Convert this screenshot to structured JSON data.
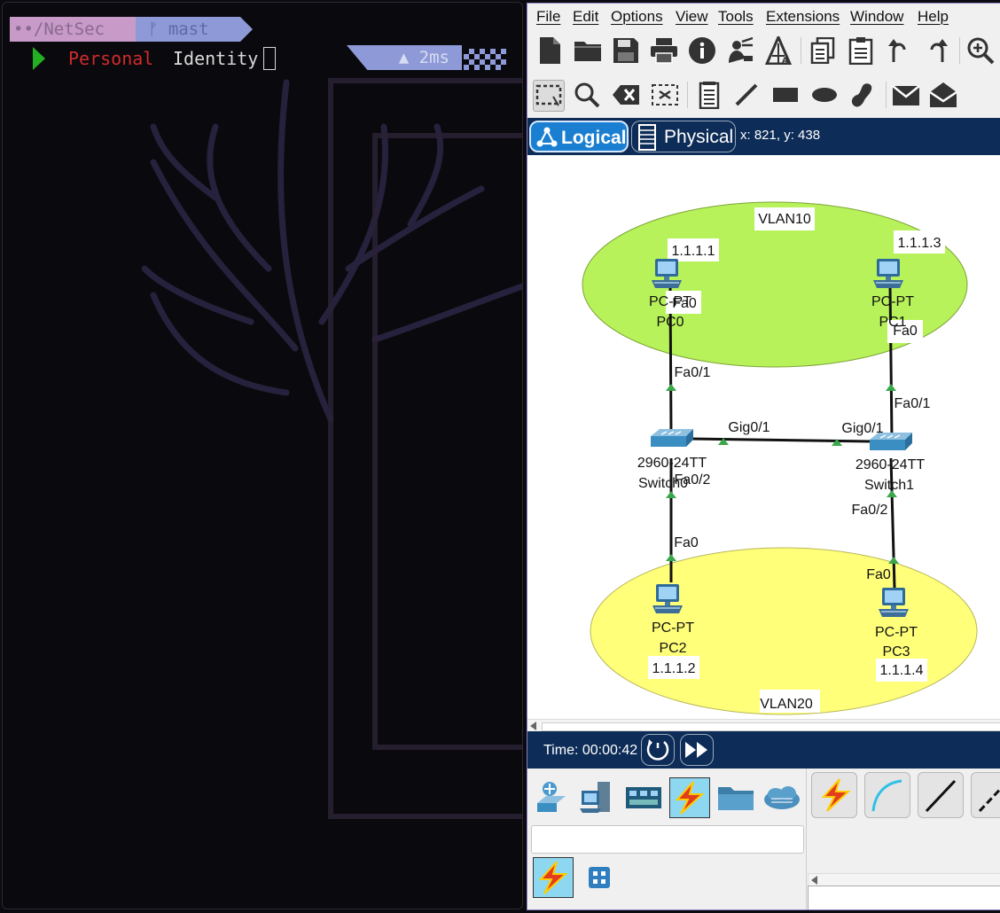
{
  "terminal": {
    "path_segment": "••/NetSec",
    "git_segment": "ᚠ mast",
    "command_word1": "Personal",
    "command_word2": "Identity",
    "exec_time": "▲ 2ms"
  },
  "packet_tracer": {
    "menu": [
      "File",
      "Edit",
      "Options",
      "View",
      "Tools",
      "Extensions",
      "Window",
      "Help"
    ],
    "toolbar1_icons": [
      "new-file-icon",
      "open-folder-icon",
      "save-icon",
      "print-icon",
      "info-icon",
      "network-wizard-icon",
      "activity-wizard-icon",
      "copy-icon",
      "paste-icon",
      "undo-icon",
      "redo-icon",
      "zoom-in-icon"
    ],
    "toolbar2_icons": [
      "select-icon",
      "inspect-icon",
      "delete-icon",
      "resize-icon",
      "note-icon",
      "line-icon",
      "rectangle-icon",
      "ellipse-icon",
      "freeform-icon",
      "add-pdu-icon",
      "add-complex-pdu-icon"
    ],
    "tabs": {
      "logical": "Logical",
      "physical": "Physical"
    },
    "coords": "x: 821, y: 438",
    "topology": {
      "vlan10": "VLAN10",
      "vlan20": "VLAN20",
      "pc0": {
        "model": "PC-PT",
        "name": "PC0",
        "ip": "1.1.1.1",
        "port": "Fa0"
      },
      "pc1": {
        "model": "PC-PT",
        "name": "PC1",
        "ip": "1.1.1.3",
        "port": "Fa0"
      },
      "pc2": {
        "model": "PC-PT",
        "name": "PC2",
        "ip": "1.1.1.2",
        "port": "Fa0"
      },
      "pc3": {
        "model": "PC-PT",
        "name": "PC3",
        "ip": "1.1.1.4",
        "port": "Fa0"
      },
      "switch0": {
        "model": "2960-24TT",
        "name": "Switch0",
        "port_up": "Fa0/1",
        "port_down": "Fa0/2",
        "port_trunk": "Gig0/1"
      },
      "switch1": {
        "model": "2960-24TT",
        "name": "Switch1",
        "port_up": "Fa0/1",
        "port_down": "Fa0/2",
        "port_trunk": "Gig0/1"
      }
    },
    "time": "Time: 00:00:42",
    "device_categories": [
      "network-devices-icon",
      "end-devices-icon",
      "components-icon",
      "connections-icon",
      "misc-icon",
      "multiuser-icon"
    ],
    "cable_types": [
      "automatic-connection-icon",
      "console-cable-icon",
      "copper-straight-icon",
      "copper-cross-icon"
    ],
    "colors": {
      "vlan10_fill": "#b7f25a",
      "vlan20_fill": "#ffff7a",
      "bar_navy": "#0d2c57",
      "link_up": "#3aa84a"
    }
  }
}
